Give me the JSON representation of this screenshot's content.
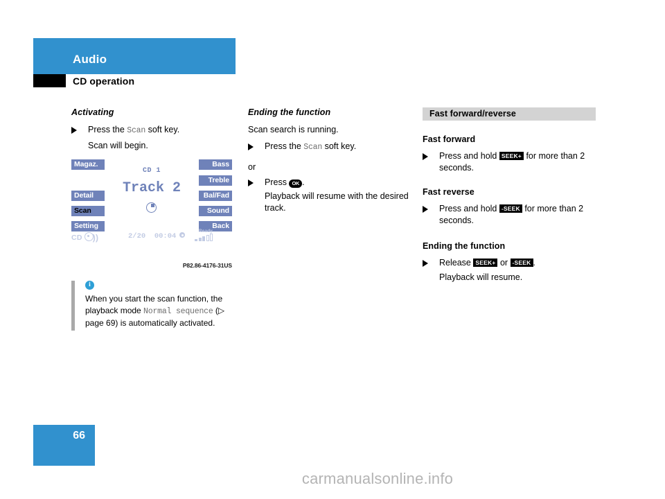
{
  "header": {
    "section_title": "Audio",
    "chapter_title": "CD operation"
  },
  "left_column": {
    "heading": "Activating",
    "step_prefix": "Press the ",
    "step_key": "Scan",
    "step_suffix": " soft key.",
    "result": "Scan will begin."
  },
  "display": {
    "left_keys": [
      {
        "label": "Magaz.",
        "active": false
      },
      {
        "label": "Detail",
        "active": false
      },
      {
        "label": "Scan",
        "active": true
      },
      {
        "label": "Setting",
        "active": false
      }
    ],
    "right_keys": [
      {
        "label": "Bass",
        "active": false
      },
      {
        "label": "Treble",
        "active": false
      },
      {
        "label": "Bal/Fad",
        "active": false
      },
      {
        "label": "Sound",
        "active": false
      },
      {
        "label": "Back",
        "active": false
      }
    ],
    "cd_label": "CD 1",
    "track_label": "Track 2",
    "source_label": "CD",
    "track_position": "2/20",
    "elapsed_time": "00:04",
    "ready_label": "Ready",
    "caption": "P82.86-4176-31US"
  },
  "info_note": {
    "icon": "info-icon",
    "text_part1": "When you start the scan function, the playback mode ",
    "mono_value": "Normal sequence",
    "text_part2": " (▷ page 69) is automatically activated."
  },
  "mid_column": {
    "heading": "Ending the function",
    "intro": "Scan search is running.",
    "step1_prefix": "Press the ",
    "step1_key": "Scan",
    "step1_suffix": " soft key.",
    "or_label": "or",
    "step2_prefix": "Press ",
    "step2_key": "OK",
    "step2_suffix": ".",
    "result": "Playback will resume with the desired track."
  },
  "right_column": {
    "section_bar": "Fast forward/reverse",
    "fast_forward_heading": "Fast forward",
    "fast_forward_prefix": "Press and hold ",
    "fast_forward_key": "SEEK+",
    "fast_forward_suffix": " for more than 2 seconds.",
    "fast_reverse_heading": "Fast reverse",
    "fast_reverse_prefix": "Press and hold ",
    "fast_reverse_key": "-SEEK",
    "fast_reverse_suffix": " for more than 2 seconds.",
    "ending_heading": "Ending the function",
    "release_prefix": "Release ",
    "release_key1": "SEEK+",
    "release_middle": " or ",
    "release_key2": "-SEEK",
    "release_suffix": ".",
    "release_result": "Playback will resume."
  },
  "footer": {
    "page_number": "66",
    "watermark": "carmanualsonline.info"
  },
  "colors": {
    "brand_blue": "#3191ce",
    "softkey_blue": "#6f82b9",
    "display_dim": "#c3cce4",
    "section_gray": "#d3d3d3",
    "info_blue": "#2e9fd6"
  }
}
